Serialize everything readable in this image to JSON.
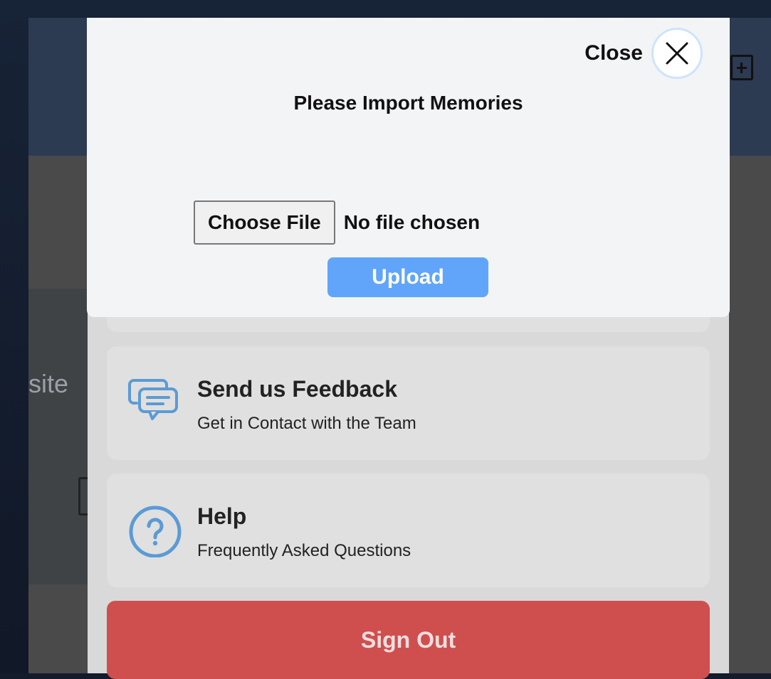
{
  "modal": {
    "close_label": "Close",
    "title": "Please Import Memories",
    "choose_file_label": "Choose File",
    "file_status": "No file chosen",
    "upload_label": "Upload"
  },
  "menu": {
    "items": [
      {
        "title": "Send us Feedback",
        "subtitle": "Get in Contact with the Team",
        "icon": "chat-bubbles-icon"
      },
      {
        "title": "Help",
        "subtitle": "Frequently Asked Questions",
        "icon": "question-circle-icon"
      }
    ],
    "sign_out_label": "Sign Out"
  },
  "background": {
    "card_partial_text": "site"
  },
  "colors": {
    "accent": "#60a5fa",
    "icon": "#5b9bd5",
    "sign_out": "#cf4f4f"
  }
}
